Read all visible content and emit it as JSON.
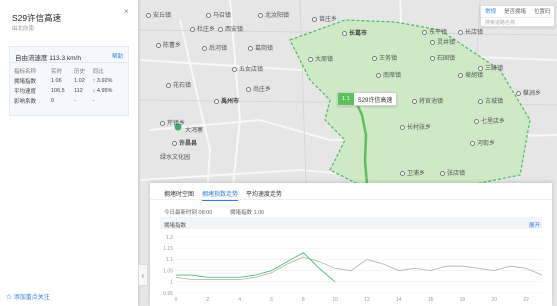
{
  "map": {
    "cities": [
      "安丘镇",
      "马召镇",
      "北汝阳镇",
      "苗庄乡",
      "西安镇",
      "杜庄乡",
      "长葛市",
      "东平镇",
      "长店镇",
      "灵井镇",
      "陈曹乡",
      "后河镇",
      "葛岗镇",
      "大周镇",
      "王务镇",
      "石固镇",
      "三峰镇",
      "五女店镇",
      "南席镇",
      "坡胡镇",
      "禹州市",
      "花石镇",
      "尚庄乡",
      "椹涧乡",
      "古城镇",
      "将官池镇",
      "长村张乡",
      "七里店乡",
      "河街乡",
      "芹镇乡",
      "许昌县",
      "卫浦乡",
      "张店镇"
    ],
    "road_label": "S29许信高速",
    "road_badge": "1.1",
    "poi": "大鸿寨",
    "poi2": "绿水文化园"
  },
  "panel": {
    "close": "×",
    "title": "S29许信高速",
    "subtitle": "由北向南",
    "free_speed": "自由流速度 113.3 km/h",
    "help": "帮助",
    "columns": [
      "指标名称",
      "实时",
      "历史",
      "同比"
    ],
    "rows": [
      {
        "name": "拥堵指数",
        "live": "1.06",
        "hist": "1.02",
        "yoy": "↑ 3.92%"
      },
      {
        "name": "平均速度",
        "live": "106.5",
        "hist": "112",
        "yoy": "↓ 4.95%"
      },
      {
        "name": "影响系数",
        "live": "0",
        "hist": "-",
        "yoy": "-"
      }
    ],
    "follow": "添加重点关注"
  },
  "toolbar": {
    "tabs": [
      "常规",
      "是否拥堵",
      "位置码"
    ],
    "search_placeholder": "搜索道路名称"
  },
  "trend": {
    "tabs": [
      "拥堵时空图",
      "拥堵指数走势",
      "平均速度走势"
    ],
    "active_tab": 1,
    "update_time": "今日最新时刻 08:00",
    "index_value": "拥堵指数 1.06",
    "expand": "展开"
  },
  "chart_data": {
    "type": "line",
    "ylabel": "拥堵指数",
    "yticks": [
      "1.2",
      "1.15",
      "1.1",
      "1.05",
      "1",
      "0.95"
    ],
    "ylim": [
      0.95,
      1.2
    ],
    "x_ticks": [
      "0",
      "2",
      "4",
      "6",
      "8",
      "10",
      "12",
      "14",
      "16",
      "18",
      "20",
      "22"
    ],
    "series": [
      {
        "name": "实时",
        "color": "#4dbb7a",
        "x": [
          0,
          1,
          2,
          3,
          4,
          5,
          6,
          7,
          8,
          9,
          10
        ],
        "values": [
          1.03,
          1.03,
          1.02,
          1.02,
          1.02,
          1.03,
          1.05,
          1.09,
          1.13,
          1.06,
          1.0
        ]
      },
      {
        "name": "历史",
        "color": "#b8b8b8",
        "x": [
          0,
          1,
          2,
          3,
          4,
          5,
          6,
          7,
          8,
          9,
          10,
          11,
          12,
          13,
          14,
          15,
          16,
          17,
          18,
          19,
          20,
          21,
          22,
          23
        ],
        "values": [
          1.02,
          1.01,
          1.01,
          1.01,
          1.01,
          1.02,
          1.04,
          1.08,
          1.11,
          1.09,
          1.06,
          1.05,
          1.1,
          1.08,
          1.05,
          1.06,
          1.05,
          1.07,
          1.07,
          1.06,
          1.05,
          1.07,
          1.06,
          1.03
        ]
      }
    ]
  }
}
